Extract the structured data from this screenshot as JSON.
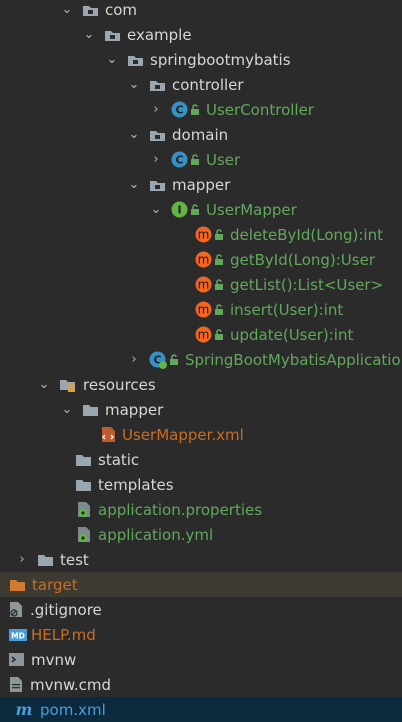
{
  "tree": {
    "com": "com",
    "example": "example",
    "springbootmybatis": "springbootmybatis",
    "controller": "controller",
    "user_controller": "UserController",
    "domain": "domain",
    "user": "User",
    "mapper_pkg": "mapper",
    "user_mapper": "UserMapper",
    "methods": [
      "deleteById(Long):int",
      "getById(Long):User",
      "getList():List<User>",
      "insert(User):int",
      "update(User):int"
    ],
    "app_class": "SpringBootMybatisApplication",
    "resources": "resources",
    "mapper_dir": "mapper",
    "user_mapper_xml": "UserMapper.xml",
    "static": "static",
    "templates": "templates",
    "application_properties": "application.properties",
    "application_yml": "application.yml",
    "test": "test",
    "target": "target",
    "gitignore": ".gitignore",
    "help_md": "HELP.md",
    "mvnw": "mvnw",
    "mvnw_cmd": "mvnw.cmd",
    "pom_xml": "pom.xml"
  },
  "icons": {
    "class_badge": "C",
    "interface_badge": "I",
    "method_badge": "m",
    "md_badge": "MD",
    "maven_badge": "m"
  },
  "colors": {
    "background": "#2b2b2b",
    "green_text": "#62a85c",
    "orange_text": "#c86e21",
    "blue_text": "#4a9ed8",
    "folder": "#9aa7b0",
    "class_icon": "#3592c4",
    "interface_icon": "#62b543",
    "method_icon": "#f26522"
  }
}
